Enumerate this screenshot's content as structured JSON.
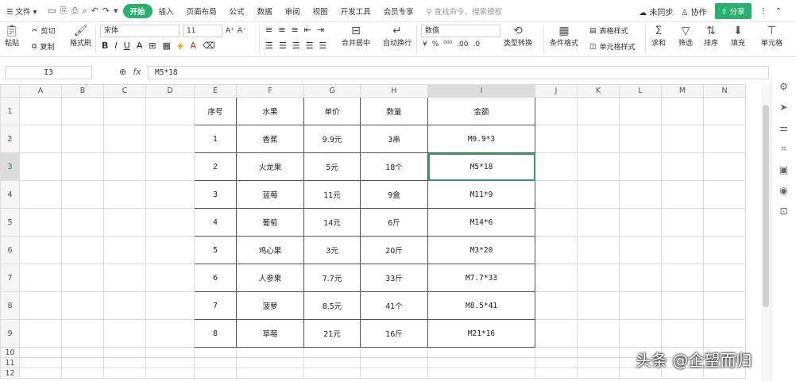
{
  "menubar": {
    "file_label": "文件",
    "tabs": [
      "开始",
      "插入",
      "页面布局",
      "公式",
      "数据",
      "审阅",
      "视图",
      "开发工具",
      "会员专享"
    ],
    "search_placeholder": "查找命令、搜索模板",
    "sync_label": "未同步",
    "collab_label": "协作",
    "share_label": "分享"
  },
  "ribbon": {
    "paste": "粘贴",
    "cut": "剪切",
    "copy": "复制",
    "format_painter": "格式刷",
    "font_name": "宋体",
    "font_size": "11",
    "merge_center": "合并居中",
    "wrap_text": "自动换行",
    "number_format": "数值",
    "type_convert": "类型转换",
    "conditional_format": "条件格式",
    "table_style": "表格样式",
    "cell_style": "单元格样式",
    "sum": "求和",
    "filter": "筛选",
    "sort": "排序",
    "fill": "填充",
    "cell": "单元格"
  },
  "formula_bar": {
    "name_box": "I3",
    "fx": "fx",
    "formula": "M5*18"
  },
  "sheet": {
    "columns": [
      "A",
      "B",
      "C",
      "D",
      "E",
      "F",
      "G",
      "H",
      "I",
      "J",
      "K",
      "L",
      "M",
      "N"
    ],
    "row_numbers": [
      "1",
      "2",
      "3",
      "4",
      "5",
      "6",
      "7",
      "8",
      "9",
      "10",
      "11",
      "12"
    ],
    "headers": [
      "序号",
      "水果",
      "单价",
      "数量",
      "金额"
    ],
    "rows": [
      [
        "1",
        "香蕉",
        "9.9元",
        "3串",
        "M9.9*3"
      ],
      [
        "2",
        "火龙果",
        "5元",
        "18个",
        "M5*18"
      ],
      [
        "3",
        "蓝莓",
        "11元",
        "9盒",
        "M11*9"
      ],
      [
        "4",
        "葡萄",
        "14元",
        "6斤",
        "M14*6"
      ],
      [
        "5",
        "鸡心果",
        "3元",
        "20斤",
        "M3*20"
      ],
      [
        "6",
        "人参果",
        "7.7元",
        "33斤",
        "M7.7*33"
      ],
      [
        "7",
        "菠萝",
        "8.5元",
        "41个",
        "M8.5*41"
      ],
      [
        "8",
        "草莓",
        "21元",
        "16斤",
        "M21*16"
      ]
    ]
  },
  "watermark": "头条 @企望而归"
}
